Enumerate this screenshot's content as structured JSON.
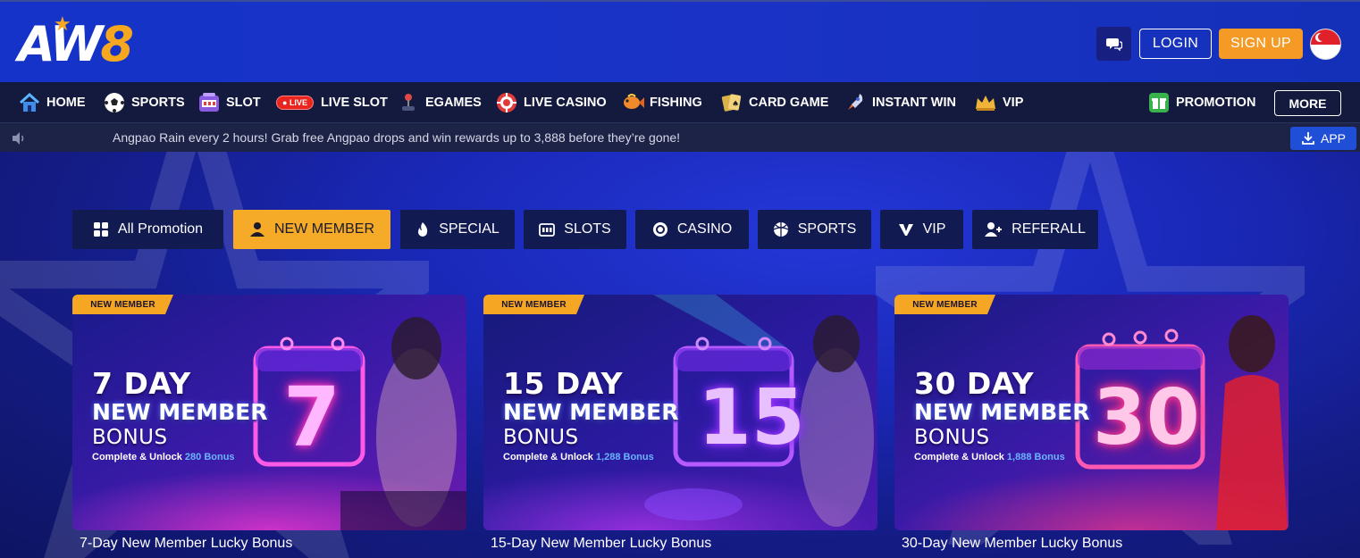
{
  "header": {
    "logo_text_main": "AW",
    "logo_text_num": "8",
    "login_label": "LOGIN",
    "signup_label": "SIGN UP"
  },
  "nav": {
    "items": [
      {
        "label": "HOME",
        "icon": "home-icon"
      },
      {
        "label": "SPORTS",
        "icon": "soccer-ball-icon"
      },
      {
        "label": "SLOT",
        "icon": "slot-machine-icon"
      },
      {
        "label": "LIVE SLOT",
        "icon": "live-badge-icon",
        "badge": "LIVE"
      },
      {
        "label": "EGAMES",
        "icon": "joystick-icon"
      },
      {
        "label": "LIVE CASINO",
        "icon": "poker-chip-icon"
      },
      {
        "label": "FISHING",
        "icon": "fish-icon"
      },
      {
        "label": "CARD GAME",
        "icon": "playing-cards-icon"
      },
      {
        "label": "INSTANT WIN",
        "icon": "rocket-icon"
      },
      {
        "label": "VIP",
        "icon": "crown-icon"
      }
    ],
    "promotion_label": "PROMOTION",
    "more_label": "MORE"
  },
  "marquee": {
    "text": "Angpao Rain every 2 hours! Grab free Angpao drops and win rewards up to 3,888 before they’re gone!",
    "app_label": "APP"
  },
  "tabs": [
    {
      "label": "All Promotion",
      "icon": "grid-icon",
      "active": false
    },
    {
      "label": "NEW MEMBER",
      "icon": "user-icon",
      "active": true
    },
    {
      "label": "SPECIAL",
      "icon": "flame-icon",
      "active": false
    },
    {
      "label": "SLOTS",
      "icon": "slot-icon",
      "active": false
    },
    {
      "label": "CASINO",
      "icon": "chip-icon",
      "active": false
    },
    {
      "label": "SPORTS",
      "icon": "ball-icon",
      "active": false
    },
    {
      "label": "VIP",
      "icon": "vip-icon",
      "active": false
    },
    {
      "label": "REFERALL",
      "icon": "add-user-icon",
      "active": false
    }
  ],
  "cards": [
    {
      "badge": "NEW MEMBER",
      "line1": "7 DAY",
      "line2": "NEW MEMBER",
      "line3": "BONUS",
      "sub_prefix": "Complete & Unlock",
      "sub_highlight": "280 Bonus",
      "big_number": "7",
      "caption": "7-Day New Member Lucky Bonus"
    },
    {
      "badge": "NEW MEMBER",
      "line1": "15 DAY",
      "line2": "NEW MEMBER",
      "line3": "BONUS",
      "sub_prefix": "Complete & Unlock",
      "sub_highlight": "1,288 Bonus",
      "big_number": "15",
      "caption": "15-Day New Member Lucky Bonus"
    },
    {
      "badge": "NEW MEMBER",
      "line1": "30 DAY",
      "line2": "NEW MEMBER",
      "line3": "BONUS",
      "sub_prefix": "Complete & Unlock",
      "sub_highlight": "1,888 Bonus",
      "big_number": "30",
      "caption": "30-Day New Member Lucky Bonus"
    }
  ],
  "colors": {
    "header_blue": "#1533c9",
    "nav_bg": "#141a3e",
    "accent_orange": "#f5a623",
    "live_red": "#e8251e",
    "app_blue": "#1f4fd6"
  }
}
